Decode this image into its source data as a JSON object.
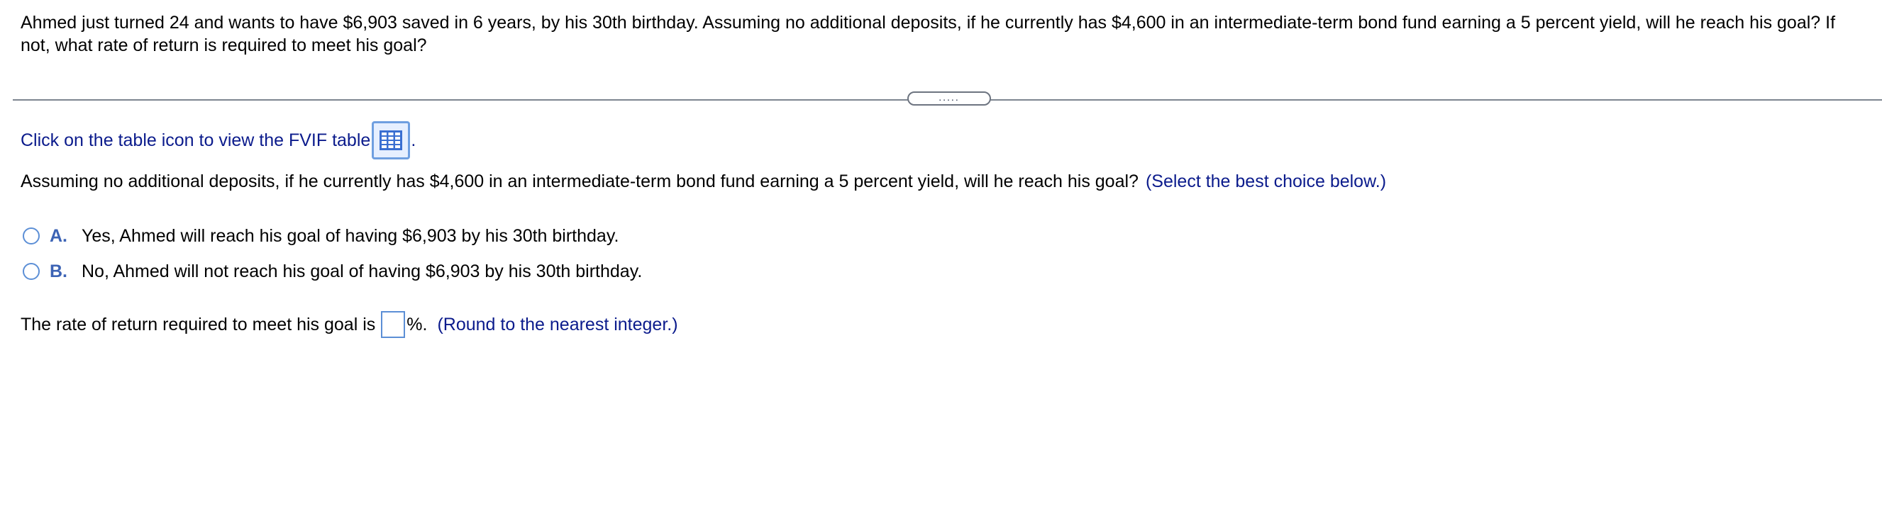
{
  "question": {
    "text": "Ahmed just turned 24 and wants to have $6,903 saved  in 6 years, by his 30th birthday. Assuming no additional deposits, if he currently has $4,600 in an intermediate-term bond fund earning a 5 percent yield, will he reach his goal? If not, what rate of return is required to meet his goal?"
  },
  "expander": {
    "label": "....."
  },
  "table_link": {
    "text": "Click on the table icon to view the FVIF table",
    "icon": "table-icon",
    "trailing": "."
  },
  "sub_question": {
    "text": "Assuming no additional deposits, if he currently has $4,600 in an intermediate-term bond fund earning a 5 percent yield, will he reach his goal?",
    "hint": "(Select the best choice below.)"
  },
  "choices": [
    {
      "letter": "A.",
      "text": "Yes, Ahmed will reach his goal of having $6,903 by his 30th birthday."
    },
    {
      "letter": "B.",
      "text": "No, Ahmed will not reach his goal of having $6,903 by his 30th birthday."
    }
  ],
  "rate": {
    "prefix": "The rate of return required to meet his goal is",
    "value": "",
    "suffix": "%.",
    "hint": "(Round to the nearest integer.)"
  },
  "colors": {
    "link_blue": "#0b1b8c",
    "accent_blue": "#5c8fd6",
    "choice_letter": "#3c63b5"
  }
}
